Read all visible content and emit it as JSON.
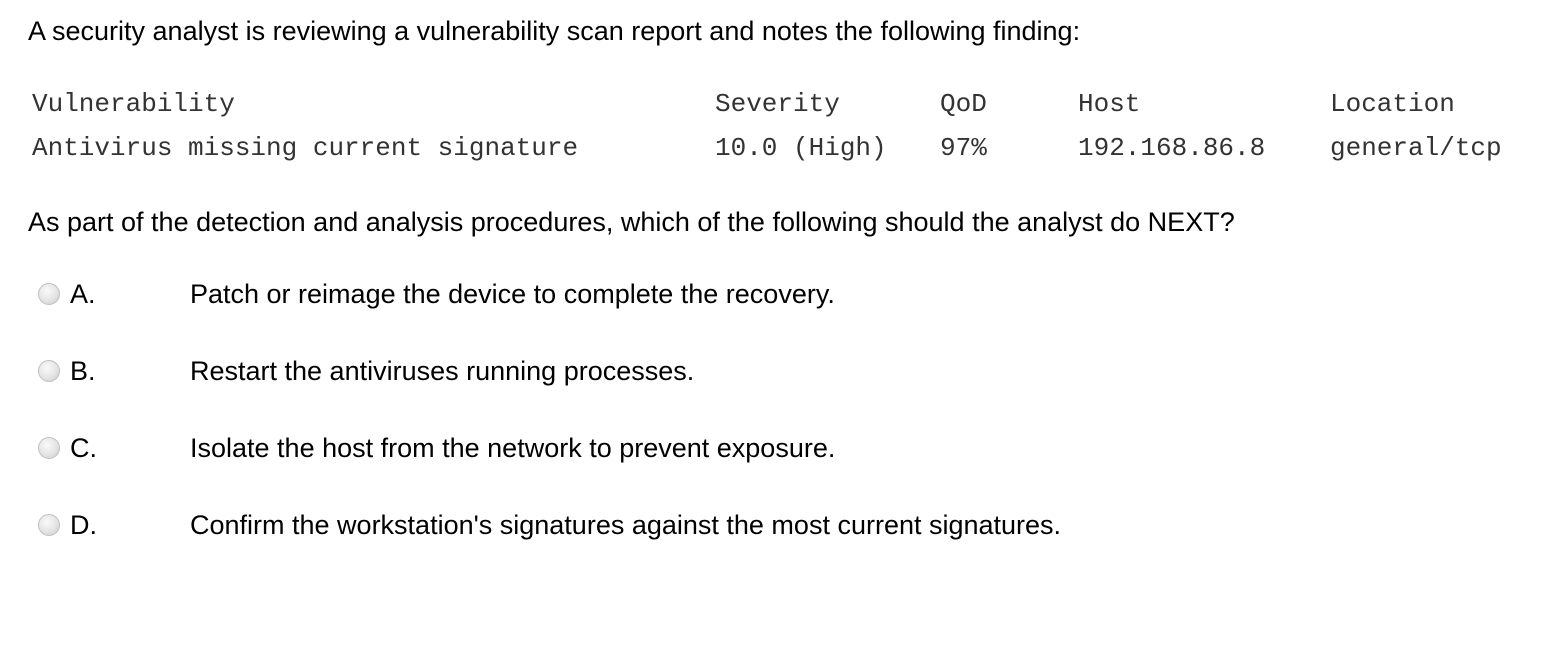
{
  "intro": "A security analyst is reviewing a vulnerability scan report and notes the following finding:",
  "finding": {
    "headers": [
      "Vulnerability",
      "Severity",
      "QoD",
      "Host",
      "Location"
    ],
    "row": [
      "Antivirus missing current signature",
      "10.0 (High)",
      "97%",
      "192.168.86.8",
      "general/tcp"
    ]
  },
  "question": "As part of the detection and analysis procedures, which of the following should the analyst do NEXT?",
  "options": [
    {
      "letter": "A.",
      "text": "Patch or reimage the device to complete the recovery.",
      "selected": false
    },
    {
      "letter": "B.",
      "text": "Restart the antiviruses running processes.",
      "selected": false
    },
    {
      "letter": "C.",
      "text": "Isolate the host from the network to prevent exposure.",
      "selected": false
    },
    {
      "letter": "D.",
      "text": "Confirm the workstation's signatures against the most current signatures.",
      "selected": false
    }
  ]
}
